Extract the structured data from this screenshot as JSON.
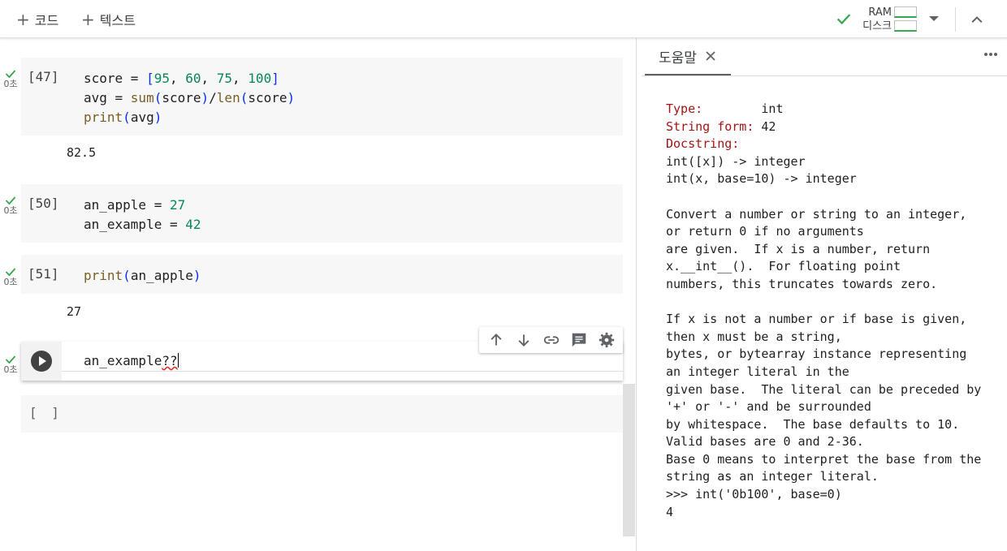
{
  "toolbar": {
    "add_code_label": "코드",
    "add_text_label": "텍스트",
    "ram_label": "RAM",
    "disk_label": "디스크"
  },
  "cells": [
    {
      "exec_count": "[47]",
      "time": "0초",
      "code_lines": [
        "score = [95, 60, 75, 100]",
        "avg = sum(score)/len(score)",
        "print(avg)"
      ],
      "output": "82.5"
    },
    {
      "exec_count": "[50]",
      "time": "0초",
      "code_lines": [
        "an_apple = 27",
        "an_example = 42"
      ],
      "output": ""
    },
    {
      "exec_count": "[51]",
      "time": "0초",
      "code_lines": [
        "print(an_apple)"
      ],
      "output": "27"
    },
    {
      "exec_count": "",
      "time": "0초",
      "code_lines": [
        "an_example??"
      ],
      "output": ""
    },
    {
      "exec_count": "[ ]",
      "time": "",
      "code_lines": [],
      "output": ""
    }
  ],
  "cell_toolbar": {
    "icons": [
      "arrow-up-icon",
      "arrow-down-icon",
      "link-icon",
      "comment-icon",
      "gear-icon"
    ]
  },
  "help": {
    "tab_label": "도움말",
    "type_key": "Type:",
    "type_value": "int",
    "string_form_key": "String form:",
    "string_form_value": "42",
    "docstring_key": "Docstring:",
    "docstring_lines": [
      "int([x]) -> integer",
      "int(x, base=10) -> integer",
      "",
      "Convert a number or string to an integer,",
      "or return 0 if no arguments",
      "are given.  If x is a number, return",
      "x.__int__().  For floating point",
      "numbers, this truncates towards zero.",
      "",
      "If x is not a number or if base is given,",
      "then x must be a string,",
      "bytes, or bytearray instance representing",
      "an integer literal in the",
      "given base.  The literal can be preceded by",
      "'+' or '-' and be surrounded",
      "by whitespace.  The base defaults to 10.",
      "Valid bases are 0 and 2-36.",
      "Base 0 means to interpret the base from the",
      "string as an integer literal.",
      ">>> int('0b100', base=0)",
      "4"
    ]
  },
  "colors": {
    "number": "#098658",
    "bracket": "#0431fa",
    "function": "#795e26",
    "help_key": "#a31515",
    "success": "#34a853"
  }
}
